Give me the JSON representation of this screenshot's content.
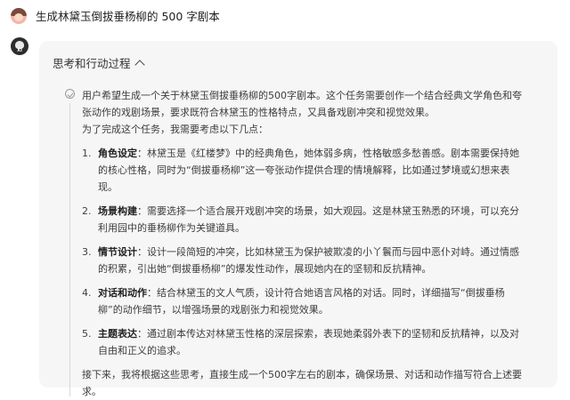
{
  "user": {
    "message": "生成林黛玉倒拔垂杨柳的 500 字剧本"
  },
  "bot": {
    "avatar_label": "XI"
  },
  "thinking": {
    "header": "思考和行动过程",
    "intro": "用户希望生成一个关于林黛玉倒拔垂杨柳的500字剧本。这个任务需要创作一个结合经典文学角色和夸张动作的戏剧场景，要求既符合林黛玉的性格特点，又具备戏剧冲突和视觉效果。",
    "lead": "为了完成这个任务，我需要考虑以下几点：",
    "items": [
      {
        "num": "1.",
        "title": "角色设定",
        "text": "：林黛玉是《红楼梦》中的经典角色，她体弱多病，性格敏感多愁善感。剧本需要保持她的核心性格，同时为“倒拔垂杨柳”这一夸张动作提供合理的情境解释，比如通过梦境或幻想来表现。"
      },
      {
        "num": "2.",
        "title": "场景构建",
        "text": "：需要选择一个适合展开戏剧冲突的场景，如大观园。这是林黛玉熟悉的环境，可以充分利用园中的垂杨柳作为关键道具。"
      },
      {
        "num": "3.",
        "title": "情节设计",
        "text": "：设计一段简短的冲突，比如林黛玉为保护被欺凌的小丫鬟而与园中恶仆对峙。通过情感的积累，引出她“倒拔垂杨柳”的爆发性动作，展现她内在的坚韧和反抗精神。"
      },
      {
        "num": "4.",
        "title": "对话和动作",
        "text": "：结合林黛玉的文人气质，设计符合她语言风格的对话。同时，详细描写“倒拔垂杨柳”的动作细节，以增强场景的戏剧张力和视觉效果。"
      },
      {
        "num": "5.",
        "title": "主题表达",
        "text": "：通过剧本传达对林黛玉性格的深层探索，表现她柔弱外表下的坚韧和反抗精神，以及对自由和正义的追求。"
      }
    ],
    "closing": "接下来，我将根据这些思考，直接生成一个500字左右的剧本，确保场景、对话和动作描写符合上述要求。"
  }
}
